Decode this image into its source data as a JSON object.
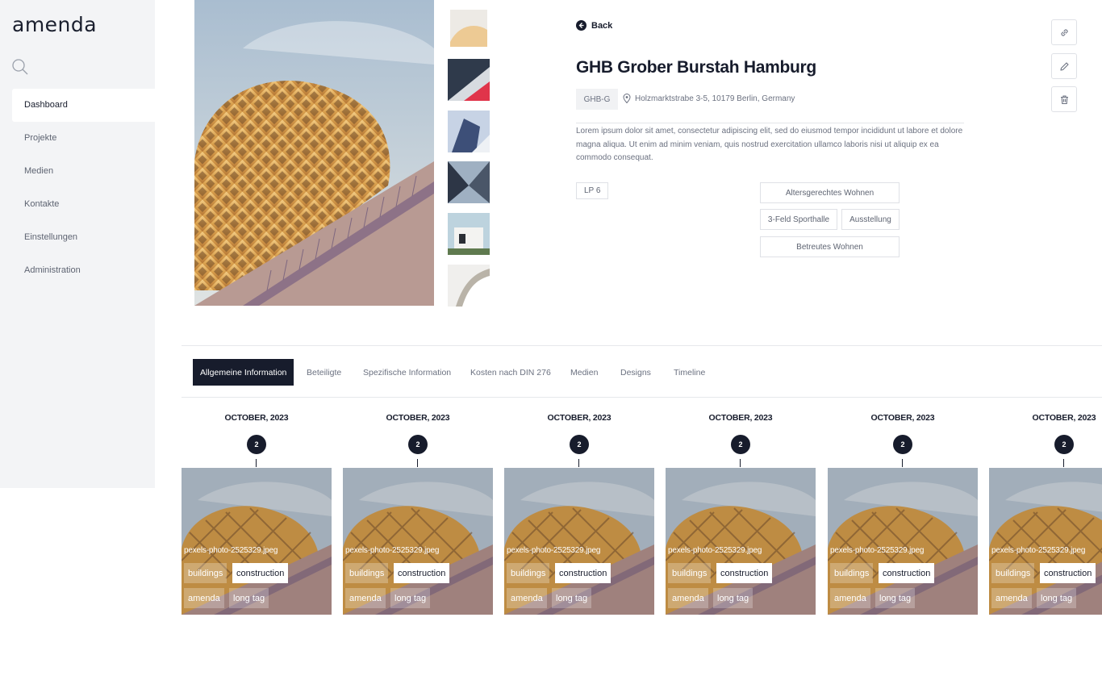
{
  "app": {
    "logo": "amenda"
  },
  "sidebar": {
    "items": [
      {
        "label": "Dashboard",
        "active": true
      },
      {
        "label": "Projekte"
      },
      {
        "label": "Medien"
      },
      {
        "label": "Kontakte"
      },
      {
        "label": "Einstellungen"
      },
      {
        "label": "Administration"
      }
    ]
  },
  "project": {
    "back_label": "Back",
    "title": "GHB Grober Burstah Hamburg",
    "code": "GHB-G",
    "address": "Holzmarktstrabe 3-5, 10179 Berlin, Germany",
    "description": "Lorem ipsum dolor sit amet, consectetur adipiscing elit, sed do eiusmod tempor incididunt ut labore et dolore magna aliqua. Ut enim ad minim veniam, quis nostrud exercitation ullamco laboris nisi ut aliquip ex ea commodo consequat.",
    "phase": "LP 6",
    "tags": [
      "Altersgerechtes Wohnen",
      "3-Feld Sporthalle",
      "Ausstellung",
      "Betreutes Wohnen"
    ]
  },
  "actions": {
    "icons": [
      "link-icon",
      "pencil-icon",
      "trash-icon"
    ]
  },
  "tabs": [
    {
      "label": "Allgemeine Information",
      "active": true
    },
    {
      "label": "Beteiligte"
    },
    {
      "label": "Spezifische Information"
    },
    {
      "label": "Kosten nach DIN 276"
    },
    {
      "label": "Medien"
    },
    {
      "label": "Designs"
    },
    {
      "label": "Timeline"
    }
  ],
  "timeline": [
    {
      "date": "OCTOBER, 2023",
      "count": "2",
      "file": "pexels-photo-2525329.jpeg",
      "tags": [
        "buildings",
        "construction",
        "amenda",
        "long tag"
      ]
    },
    {
      "date": "OCTOBER, 2023",
      "count": "2",
      "file": "pexels-photo-2525329.jpeg",
      "tags": [
        "buildings",
        "construction",
        "amenda",
        "long tag"
      ]
    },
    {
      "date": "OCTOBER, 2023",
      "count": "2",
      "file": "pexels-photo-2525329.jpeg",
      "tags": [
        "buildings",
        "construction",
        "amenda",
        "long tag"
      ]
    },
    {
      "date": "OCTOBER, 2023",
      "count": "2",
      "file": "pexels-photo-2525329.jpeg",
      "tags": [
        "buildings",
        "construction",
        "amenda",
        "long tag"
      ]
    },
    {
      "date": "OCTOBER, 2023",
      "count": "2",
      "file": "pexels-photo-2525329.jpeg",
      "tags": [
        "buildings",
        "construction",
        "amenda",
        "long tag"
      ]
    },
    {
      "date": "OCTOBER, 2023",
      "count": "2",
      "file": "pexels-photo-2525329.jpeg",
      "tags": [
        "buildings",
        "construction",
        "amenda",
        "long tag"
      ]
    }
  ],
  "colors": {
    "primary": "#171c2c",
    "sidebar_bg": "#f3f4f6",
    "muted_text": "#6b7180",
    "border": "#dfe1e6"
  }
}
